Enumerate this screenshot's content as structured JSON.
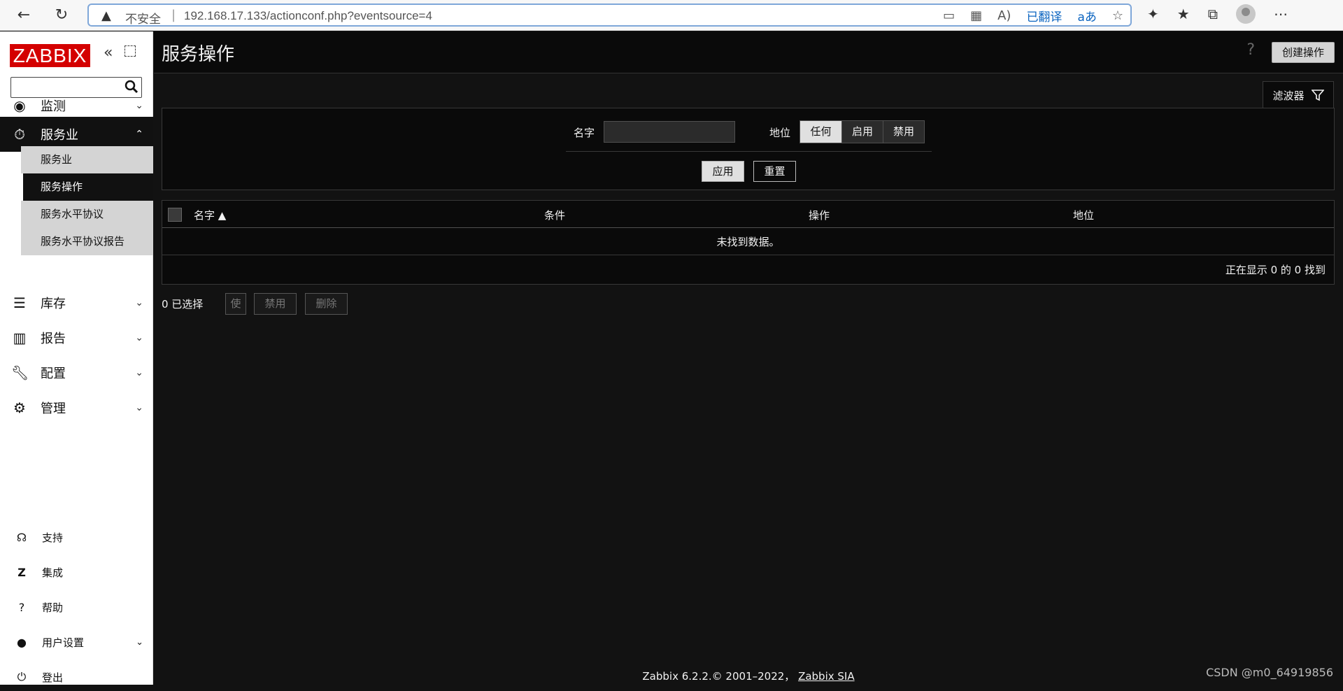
{
  "browser": {
    "security_label": "不安全",
    "url": "192.168.17.133/actionconf.php?eventsource=4",
    "translate_label": "已翻译"
  },
  "sidebar": {
    "logo": "ZABBIX",
    "menu": [
      {
        "label": "监测",
        "icon": "eye-icon"
      },
      {
        "label": "服务业",
        "icon": "stopwatch-icon"
      },
      {
        "label": "库存",
        "icon": "list-icon"
      },
      {
        "label": "报告",
        "icon": "bar-chart-icon"
      },
      {
        "label": "配置",
        "icon": "wrench-icon"
      },
      {
        "label": "管理",
        "icon": "gear-icon"
      }
    ],
    "submenu": [
      "服务业",
      "服务操作",
      "服务水平协议",
      "服务水平协议报告"
    ],
    "bottom": [
      {
        "label": "支持",
        "icon": "headset-icon"
      },
      {
        "label": "集成",
        "icon": "zabbix-z-icon"
      },
      {
        "label": "帮助",
        "icon": "question-icon"
      },
      {
        "label": "用户设置",
        "icon": "user-icon"
      },
      {
        "label": "登出",
        "icon": "power-icon"
      }
    ]
  },
  "header": {
    "title": "服务操作",
    "help": "?",
    "create_button": "创建操作"
  },
  "filter": {
    "tab_label": "滤波器",
    "name_label": "名字",
    "status_label": "地位",
    "status_options": [
      "任何",
      "启用",
      "禁用"
    ],
    "selected_status": "任何",
    "apply": "应用",
    "reset": "重置"
  },
  "table": {
    "columns": [
      "名字 ▲",
      "条件",
      "操作",
      "地位"
    ],
    "empty_message": "未找到数据。",
    "paging": "正在显示 0 的 0 找到"
  },
  "mass_actions": {
    "selected": "0 已选择",
    "buttons": [
      "使",
      "禁用",
      "删除"
    ]
  },
  "footer": {
    "text": "Zabbix 6.2.2.© 2001–2022，",
    "link": "Zabbix SIA"
  },
  "watermark": "CSDN @m0_64919856",
  "colors": {
    "brand": "#d40000",
    "background": "#121212",
    "panel": "#0a0a0a"
  }
}
